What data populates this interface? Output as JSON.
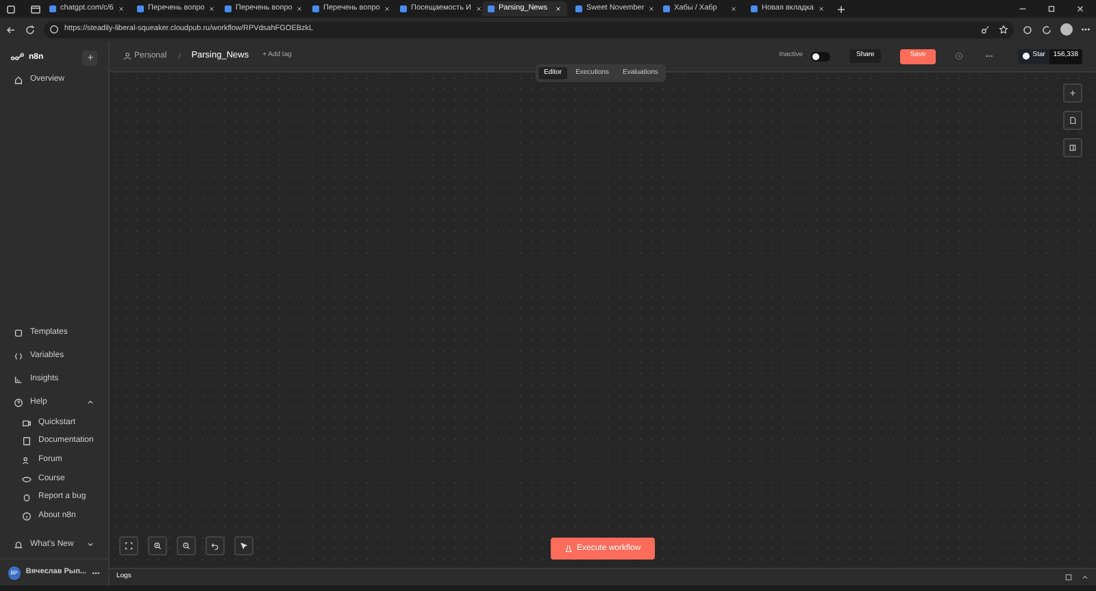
{
  "browser": {
    "tabs": [
      {
        "title": "chatgpt.com/c/6",
        "selected": false
      },
      {
        "title": "Перечень вопро",
        "selected": false
      },
      {
        "title": "Перечень вопро",
        "selected": false
      },
      {
        "title": "Перечень вопро",
        "selected": false
      },
      {
        "title": "Посещаемость И",
        "selected": false
      },
      {
        "title": "Parsing_News",
        "selected": true
      },
      {
        "title": "Sweet November",
        "selected": false
      },
      {
        "title": "Хабы / Хабр",
        "selected": false
      },
      {
        "title": "Новая вкладка",
        "selected": false
      }
    ],
    "url": "https://steadily-liberal-squeaker.cloudpub.ru/workflow/RPVdsahFGOEBzkL"
  },
  "sidebar": {
    "logo": "n8n",
    "top_items": [
      {
        "label": "Overview"
      }
    ],
    "bottom_items": [
      {
        "label": "Templates"
      },
      {
        "label": "Variables"
      },
      {
        "label": "Insights"
      }
    ],
    "help": {
      "label": "Help",
      "expanded": true,
      "children": [
        {
          "label": "Quickstart"
        },
        {
          "label": "Documentation"
        },
        {
          "label": "Forum"
        },
        {
          "label": "Course"
        },
        {
          "label": "Report a bug"
        },
        {
          "label": "About n8n"
        }
      ]
    },
    "whats_new": "What's New",
    "user": {
      "name": "Вячеслав Рып...",
      "initials": "ВР"
    }
  },
  "header": {
    "project": "Personal",
    "workflow": "Parsing_News",
    "add_tag": "+ Add tag",
    "active_label": "Inactive",
    "active": false,
    "share": "Share",
    "save": "Save",
    "star": "Star",
    "star_count": "156,338"
  },
  "view_tabs": [
    {
      "label": "Editor",
      "selected": true
    },
    {
      "label": "Executions",
      "selected": false
    },
    {
      "label": "Evaluations",
      "selected": false
    }
  ],
  "execute": "Execute workflow",
  "logs": "Logs"
}
